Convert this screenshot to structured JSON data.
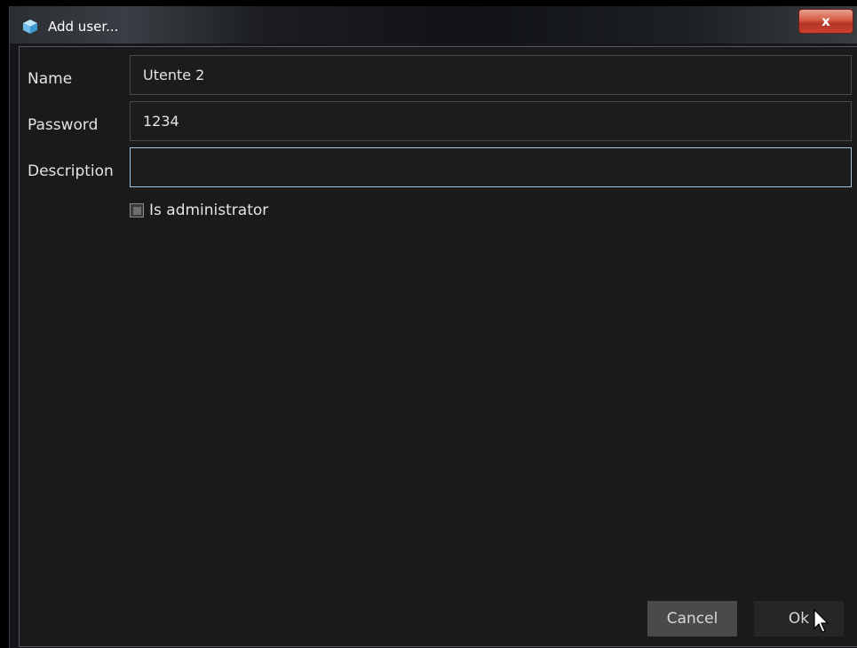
{
  "window": {
    "title": "Add user...",
    "close_label": "x"
  },
  "form": {
    "name": {
      "label": "Name",
      "value": "Utente 2"
    },
    "password": {
      "label": "Password",
      "value": "1234"
    },
    "description": {
      "label": "Description",
      "value": ""
    },
    "is_administrator": {
      "label": "Is administrator",
      "checked": false
    }
  },
  "buttons": {
    "cancel_label": "Cancel",
    "ok_label": "Ok"
  },
  "icons": {
    "app": "cube-icon",
    "close": "close-icon",
    "pointer": "mouse-pointer-icon"
  },
  "colors": {
    "background": "#1a1a1a",
    "focus_border": "#9cc6e0",
    "close_button": "#c8422e",
    "app_icon": "#7fc8ef"
  }
}
